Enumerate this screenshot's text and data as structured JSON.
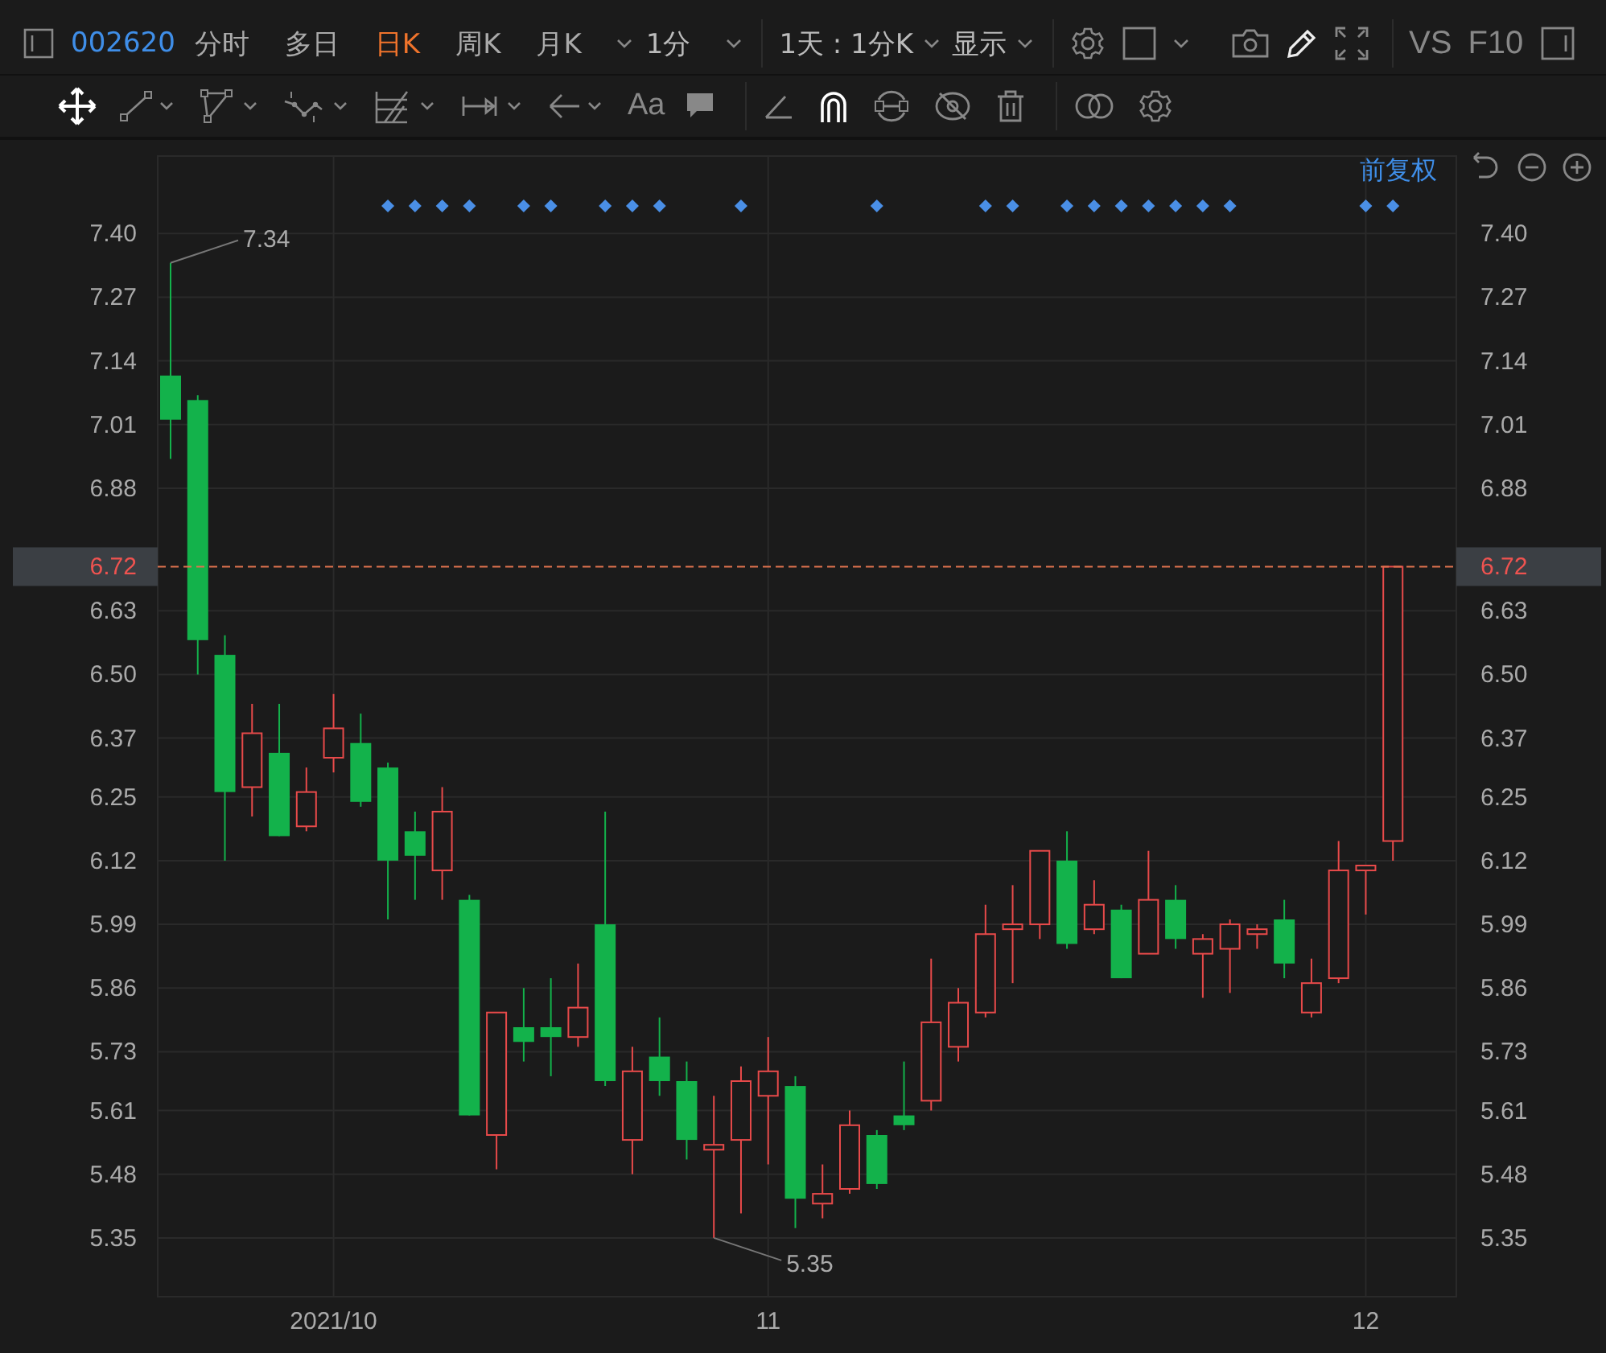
{
  "toolbar": {
    "symbol": "002620",
    "tabs": [
      {
        "label": "分时",
        "selected": false
      },
      {
        "label": "多日",
        "selected": false
      },
      {
        "label": "日K",
        "selected": true
      },
      {
        "label": "周K",
        "selected": false
      },
      {
        "label": "月K",
        "selected": false
      }
    ],
    "period": "1分",
    "range": "1天 : 1分K",
    "display": "显示",
    "vs": "VS",
    "f10": "F10"
  },
  "drawing_tools": {
    "text_tool": "Aa"
  },
  "chart": {
    "adjust": "前复权",
    "right_price_tag": "6.72",
    "right_axis_labels": [
      "7.40",
      "7.27",
      "7.14",
      "7.01",
      "6.88",
      "6.63",
      "6.50",
      "6.37",
      "6.25",
      "6.12",
      "5.99",
      "5.86",
      "5.73",
      "5.61",
      "5.48",
      "5.35"
    ],
    "signals": [
      false,
      false,
      false,
      false,
      false,
      false,
      false,
      false,
      true,
      true,
      true,
      true,
      false,
      true,
      true,
      false,
      true,
      true,
      true,
      false,
      false,
      true,
      false,
      false,
      false,
      false,
      true,
      false,
      false,
      false,
      true,
      true,
      false,
      true,
      true,
      true,
      true,
      true,
      true,
      true,
      false,
      false,
      false,
      false,
      true,
      true
    ],
    "chart_data": {
      "type": "candlestick",
      "grid": true,
      "ylim": [
        5.23,
        7.558
      ],
      "yticks": [
        {
          "value": 7.4,
          "label": "7.40"
        },
        {
          "value": 7.27,
          "label": "7.27"
        },
        {
          "value": 7.14,
          "label": "7.14"
        },
        {
          "value": 7.01,
          "label": "7.01"
        },
        {
          "value": 6.88,
          "label": "6.88"
        },
        {
          "value": 6.63,
          "label": "6.63"
        },
        {
          "value": 6.5,
          "label": "6.50"
        },
        {
          "value": 6.37,
          "label": "6.37"
        },
        {
          "value": 6.25,
          "label": "6.25"
        },
        {
          "value": 6.12,
          "label": "6.12"
        },
        {
          "value": 5.99,
          "label": "5.99"
        },
        {
          "value": 5.86,
          "label": "5.86"
        },
        {
          "value": 5.73,
          "label": "5.73"
        },
        {
          "value": 5.61,
          "label": "5.61"
        },
        {
          "value": 5.48,
          "label": "5.48"
        },
        {
          "value": 5.35,
          "label": "5.35"
        }
      ],
      "categories": [
        null,
        null,
        null,
        null,
        null,
        null,
        "2021/10",
        null,
        null,
        null,
        null,
        null,
        null,
        null,
        null,
        null,
        null,
        null,
        null,
        null,
        null,
        null,
        "11",
        null,
        null,
        null,
        null,
        null,
        null,
        null,
        null,
        null,
        null,
        null,
        null,
        null,
        null,
        null,
        null,
        null,
        null,
        null,
        null,
        null,
        "12",
        null
      ],
      "ohlc": [
        [
          7.11,
          7.34,
          6.94,
          7.02
        ],
        [
          7.06,
          7.07,
          6.5,
          6.57
        ],
        [
          6.54,
          6.58,
          6.12,
          6.26
        ],
        [
          6.27,
          6.44,
          6.21,
          6.38
        ],
        [
          6.34,
          6.44,
          6.17,
          6.17
        ],
        [
          6.19,
          6.31,
          6.18,
          6.26
        ],
        [
          6.33,
          6.46,
          6.3,
          6.39
        ],
        [
          6.36,
          6.42,
          6.23,
          6.24
        ],
        [
          6.31,
          6.32,
          6.0,
          6.12
        ],
        [
          6.18,
          6.22,
          6.04,
          6.13
        ],
        [
          6.1,
          6.27,
          6.04,
          6.22
        ],
        [
          6.04,
          6.05,
          5.6,
          5.6
        ],
        [
          5.56,
          5.81,
          5.49,
          5.81
        ],
        [
          5.78,
          5.86,
          5.71,
          5.75
        ],
        [
          5.78,
          5.88,
          5.68,
          5.76
        ],
        [
          5.76,
          5.91,
          5.74,
          5.82
        ],
        [
          5.99,
          6.22,
          5.66,
          5.67
        ],
        [
          5.55,
          5.74,
          5.48,
          5.69
        ],
        [
          5.72,
          5.8,
          5.64,
          5.67
        ],
        [
          5.67,
          5.71,
          5.51,
          5.55
        ],
        [
          5.53,
          5.64,
          5.35,
          5.54
        ],
        [
          5.55,
          5.7,
          5.4,
          5.67
        ],
        [
          5.64,
          5.76,
          5.5,
          5.69
        ],
        [
          5.66,
          5.68,
          5.37,
          5.43
        ],
        [
          5.42,
          5.5,
          5.39,
          5.44
        ],
        [
          5.45,
          5.61,
          5.44,
          5.58
        ],
        [
          5.56,
          5.57,
          5.45,
          5.46
        ],
        [
          5.6,
          5.71,
          5.57,
          5.58
        ],
        [
          5.63,
          5.92,
          5.61,
          5.79
        ],
        [
          5.74,
          5.86,
          5.71,
          5.83
        ],
        [
          5.81,
          6.03,
          5.8,
          5.97
        ],
        [
          5.98,
          6.07,
          5.87,
          5.99
        ],
        [
          5.99,
          6.14,
          5.96,
          6.14
        ],
        [
          6.12,
          6.18,
          5.94,
          5.95
        ],
        [
          5.98,
          6.08,
          5.97,
          6.03
        ],
        [
          6.02,
          6.03,
          5.88,
          5.88
        ],
        [
          5.93,
          6.14,
          5.93,
          6.04
        ],
        [
          6.04,
          6.07,
          5.94,
          5.96
        ],
        [
          5.93,
          5.97,
          5.84,
          5.96
        ],
        [
          5.94,
          6.0,
          5.85,
          5.99
        ],
        [
          5.97,
          5.99,
          5.94,
          5.98
        ],
        [
          6.0,
          6.04,
          5.88,
          5.91
        ],
        [
          5.81,
          5.92,
          5.8,
          5.87
        ],
        [
          5.88,
          6.16,
          5.87,
          6.1
        ],
        [
          6.1,
          6.11,
          6.01,
          6.11
        ],
        [
          6.16,
          6.72,
          6.12,
          6.72
        ]
      ],
      "ref_lines": [
        {
          "axis": "y",
          "value": 6.72,
          "label": "6.72"
        }
      ],
      "annotations": [
        "7.34",
        "5.35"
      ]
    }
  }
}
